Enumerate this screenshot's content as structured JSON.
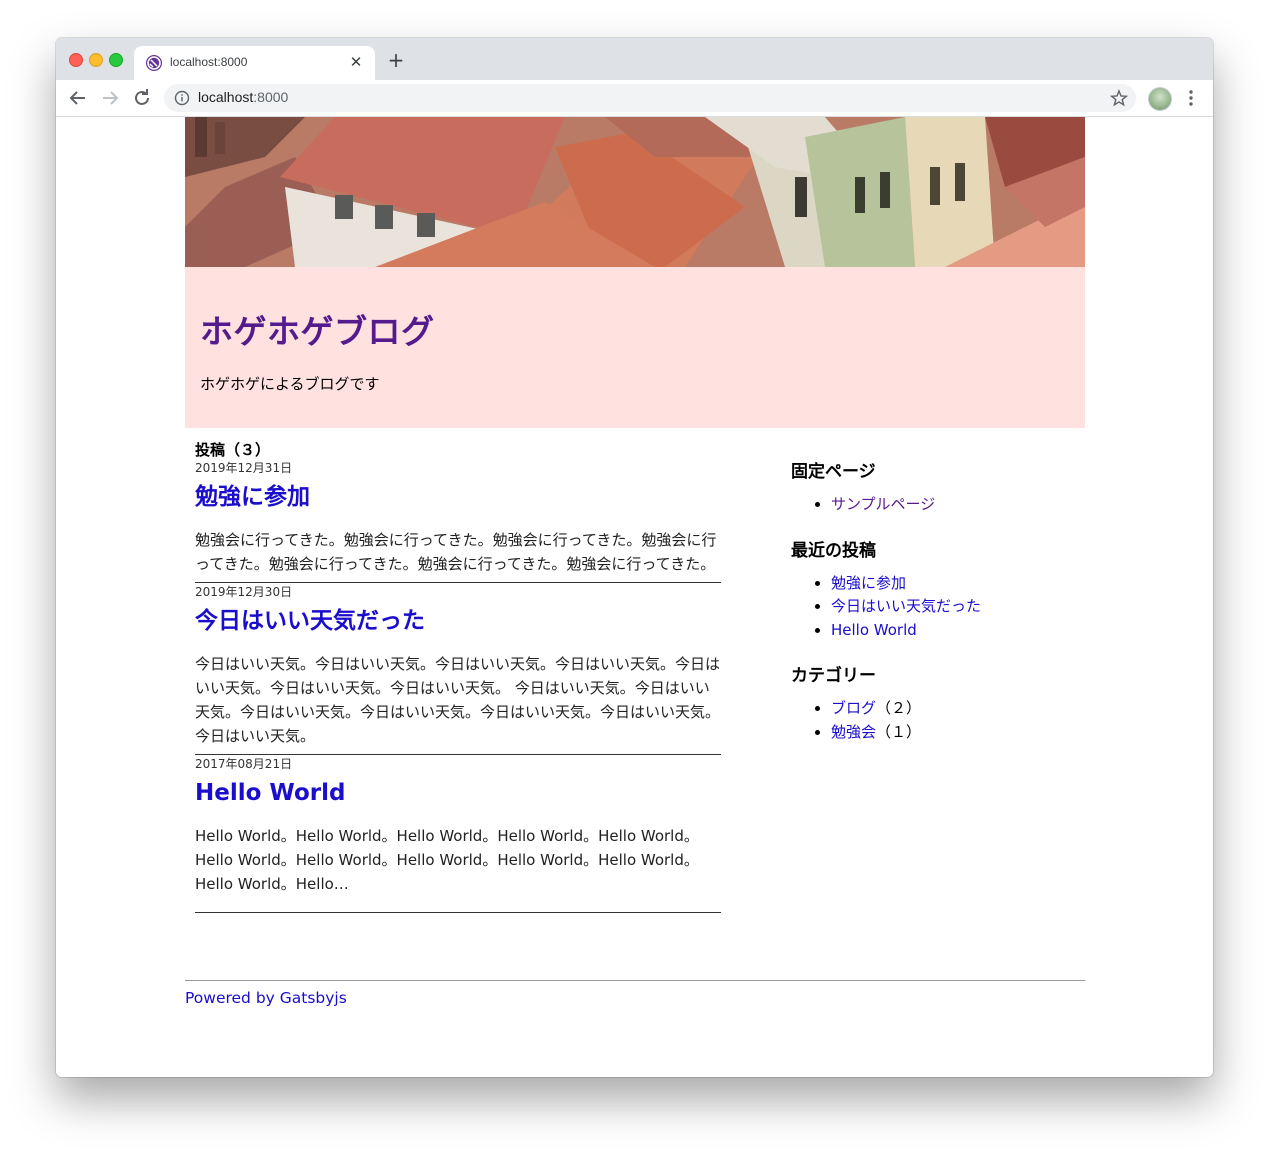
{
  "browser": {
    "tab_title": "localhost:8000",
    "url_host": "localhost",
    "url_port": ":8000"
  },
  "header": {
    "site_title": "ホゲホゲブログ",
    "description": "ホゲホゲによるブログです"
  },
  "posts": {
    "count_label": "投稿（３）",
    "items": [
      {
        "date": "2019年12月31日",
        "title": "勉強に参加",
        "excerpt": "勉強会に行ってきた。勉強会に行ってきた。勉強会に行ってきた。勉強会に行ってきた。勉強会に行ってきた。勉強会に行ってきた。勉強会に行ってきた。"
      },
      {
        "date": "2019年12月30日",
        "title": "今日はいい天気だった",
        "excerpt": "今日はいい天気。今日はいい天気。今日はいい天気。今日はいい天気。今日はいい天気。今日はいい天気。今日はいい天気。 今日はいい天気。今日はいい天気。今日はいい天気。今日はいい天気。今日はいい天気。今日はいい天気。今日はいい天気。"
      },
      {
        "date": "2017年08月21日",
        "title": "Hello World",
        "excerpt": "Hello World。Hello World。Hello World。Hello World。Hello World。Hello World。Hello World。Hello World。Hello World。Hello World。Hello World。Hello…"
      }
    ]
  },
  "sidebar": {
    "pages": {
      "title": "固定ページ",
      "items": [
        "サンプルページ"
      ]
    },
    "recent": {
      "title": "最近の投稿",
      "items": [
        "勉強に参加",
        "今日はいい天気だった",
        "Hello World"
      ]
    },
    "categories": {
      "title": "カテゴリー",
      "items": [
        {
          "name": "ブログ",
          "count": "（２）"
        },
        {
          "name": "勉強会",
          "count": "（１）"
        }
      ]
    }
  },
  "footer": {
    "link_text": "Powered by Gatsbyjs"
  },
  "colors": {
    "header_bg": "#ffe1e0",
    "title": "#551a8b",
    "link": "#1a0dcc"
  }
}
